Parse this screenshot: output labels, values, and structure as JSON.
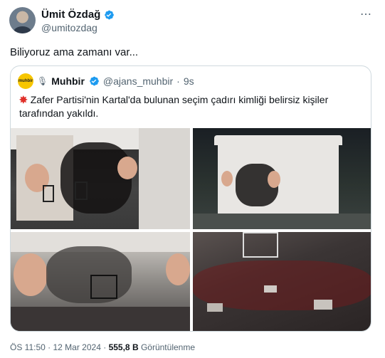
{
  "tweet": {
    "author_name": "Ümit Özdağ",
    "handle": "@umitozdag",
    "text": "Biliyoruz ama zamanı var...",
    "more_icon": "⋯"
  },
  "quote": {
    "avatar_text": "muhbir",
    "author_name": "Muhbir",
    "handle": "@ajans_muhbir",
    "separator": "·",
    "age": "9s",
    "text": "Zafer Partisi'nin Kartal'da bulunan seçim çadırı kimliği belirsiz kişiler tarafından yakıldı.",
    "burst_icon": "✸",
    "mic_icon": "🎙"
  },
  "photos": [
    "burned-tent-interior",
    "tent-exterior-night",
    "tent-interior-wide",
    "burned-ground-debris"
  ],
  "footer": {
    "time": "ÖS 11:50",
    "separator": "·",
    "date": "12 Mar 2024",
    "views_value": "555,8 B",
    "views_label": "Görüntülenme"
  },
  "colors": {
    "verified": "#1d9bf0",
    "secondary_text": "#536471",
    "border": "#cfd9de"
  }
}
